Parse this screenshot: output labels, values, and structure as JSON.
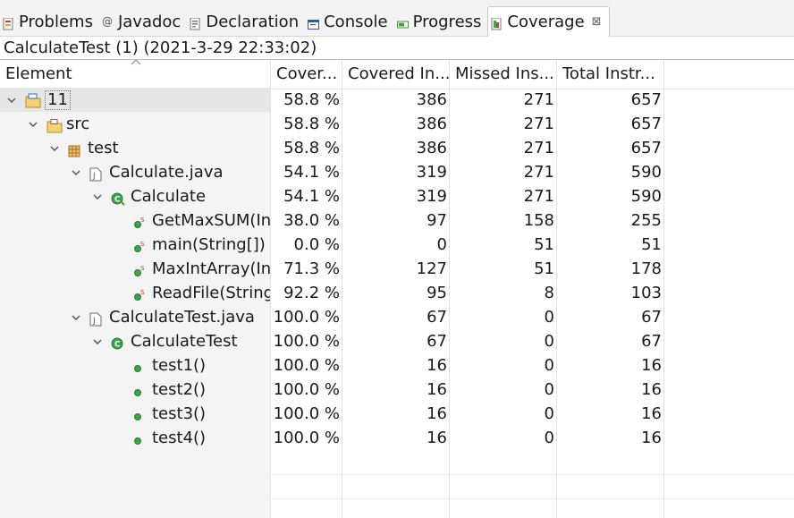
{
  "tabs": [
    {
      "label": "Problems",
      "icon": "problems-icon"
    },
    {
      "label": "Javadoc",
      "icon": "javadoc-icon"
    },
    {
      "label": "Declaration",
      "icon": "declaration-icon"
    },
    {
      "label": "Console",
      "icon": "console-icon"
    },
    {
      "label": "Progress",
      "icon": "progress-icon"
    },
    {
      "label": "Coverage",
      "icon": "coverage-icon",
      "active": true
    }
  ],
  "close_glyph": "⊠",
  "session_label": "CalculateTest (1) (2021-3-29 22:33:02)",
  "columns": [
    "Element",
    "Cover...",
    "Covered In...",
    "Missed Ins...",
    "Total Instr..."
  ],
  "rows": [
    {
      "name": "11",
      "kind": "project",
      "coverage": "58.8 %",
      "covered": "386",
      "missed": "271",
      "total": "657",
      "selected": true
    },
    {
      "name": "src",
      "kind": "source-folder",
      "coverage": "58.8 %",
      "covered": "386",
      "missed": "271",
      "total": "657"
    },
    {
      "name": "test",
      "kind": "package",
      "coverage": "58.8 %",
      "covered": "386",
      "missed": "271",
      "total": "657"
    },
    {
      "name": "Calculate.java",
      "kind": "java-file",
      "coverage": "54.1 %",
      "covered": "319",
      "missed": "271",
      "total": "590"
    },
    {
      "name": "Calculate",
      "kind": "class",
      "coverage": "54.1 %",
      "covered": "319",
      "missed": "271",
      "total": "590"
    },
    {
      "name": "GetMaxSUM(In",
      "kind": "static-method",
      "coverage": "38.0 %",
      "covered": "97",
      "missed": "158",
      "total": "255"
    },
    {
      "name": "main(String[])",
      "kind": "static-method",
      "coverage": "0.0 %",
      "covered": "0",
      "missed": "51",
      "total": "51"
    },
    {
      "name": "MaxIntArray(In",
      "kind": "static-method",
      "coverage": "71.3 %",
      "covered": "127",
      "missed": "51",
      "total": "178"
    },
    {
      "name": "ReadFile(String",
      "kind": "static-method",
      "coverage": "92.2 %",
      "covered": "95",
      "missed": "8",
      "total": "103"
    },
    {
      "name": "CalculateTest.java",
      "kind": "java-file",
      "coverage": "100.0 %",
      "covered": "67",
      "missed": "0",
      "total": "67"
    },
    {
      "name": "CalculateTest",
      "kind": "class-plain",
      "coverage": "100.0 %",
      "covered": "67",
      "missed": "0",
      "total": "67"
    },
    {
      "name": "test1()",
      "kind": "method",
      "coverage": "100.0 %",
      "covered": "16",
      "missed": "0",
      "total": "16"
    },
    {
      "name": "test2()",
      "kind": "method",
      "coverage": "100.0 %",
      "covered": "16",
      "missed": "0",
      "total": "16"
    },
    {
      "name": "test3()",
      "kind": "method",
      "coverage": "100.0 %",
      "covered": "16",
      "missed": "0",
      "total": "16"
    },
    {
      "name": "test4()",
      "kind": "method",
      "coverage": "100.0 %",
      "covered": "16",
      "missed": "0",
      "total": "16"
    }
  ]
}
